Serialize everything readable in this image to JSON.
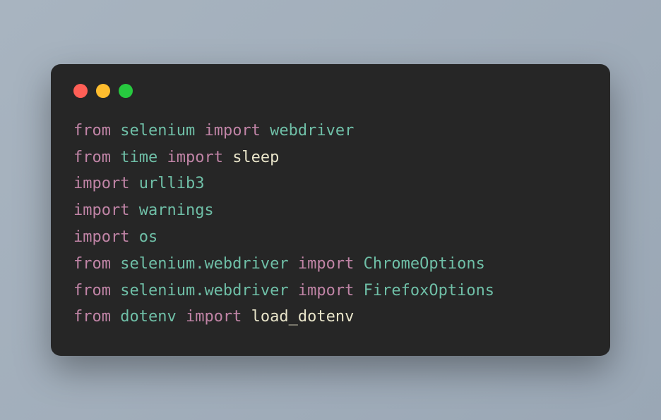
{
  "colors": {
    "background": "#a8b4c0",
    "window": "#262626",
    "keyword": "#c084a6",
    "module": "#6fbfa7",
    "name": "#e8e4c9",
    "dot_red": "#ff5f56",
    "dot_yellow": "#ffbd2e",
    "dot_green": "#27c93f"
  },
  "code": {
    "lines": [
      {
        "tokens": [
          {
            "t": "from ",
            "c": "kw"
          },
          {
            "t": "selenium ",
            "c": "mod"
          },
          {
            "t": "import ",
            "c": "kw"
          },
          {
            "t": "webdriver",
            "c": "mod"
          }
        ]
      },
      {
        "tokens": [
          {
            "t": "from ",
            "c": "kw"
          },
          {
            "t": "time ",
            "c": "mod"
          },
          {
            "t": "import ",
            "c": "kw"
          },
          {
            "t": "sleep",
            "c": "name"
          }
        ]
      },
      {
        "tokens": [
          {
            "t": "import ",
            "c": "kw"
          },
          {
            "t": "urllib3",
            "c": "mod"
          }
        ]
      },
      {
        "tokens": [
          {
            "t": "import ",
            "c": "kw"
          },
          {
            "t": "warnings",
            "c": "mod"
          }
        ]
      },
      {
        "tokens": [
          {
            "t": "import ",
            "c": "kw"
          },
          {
            "t": "os",
            "c": "mod"
          }
        ]
      },
      {
        "tokens": [
          {
            "t": "from ",
            "c": "kw"
          },
          {
            "t": "selenium.webdriver ",
            "c": "mod"
          },
          {
            "t": "import ",
            "c": "kw"
          },
          {
            "t": "ChromeOptions",
            "c": "mod"
          }
        ]
      },
      {
        "tokens": [
          {
            "t": "from ",
            "c": "kw"
          },
          {
            "t": "selenium.webdriver ",
            "c": "mod"
          },
          {
            "t": "import ",
            "c": "kw"
          },
          {
            "t": "FirefoxOptions",
            "c": "mod"
          }
        ]
      },
      {
        "tokens": [
          {
            "t": "from ",
            "c": "kw"
          },
          {
            "t": "dotenv ",
            "c": "mod"
          },
          {
            "t": "import ",
            "c": "kw"
          },
          {
            "t": "load_dotenv",
            "c": "name"
          }
        ]
      }
    ]
  }
}
